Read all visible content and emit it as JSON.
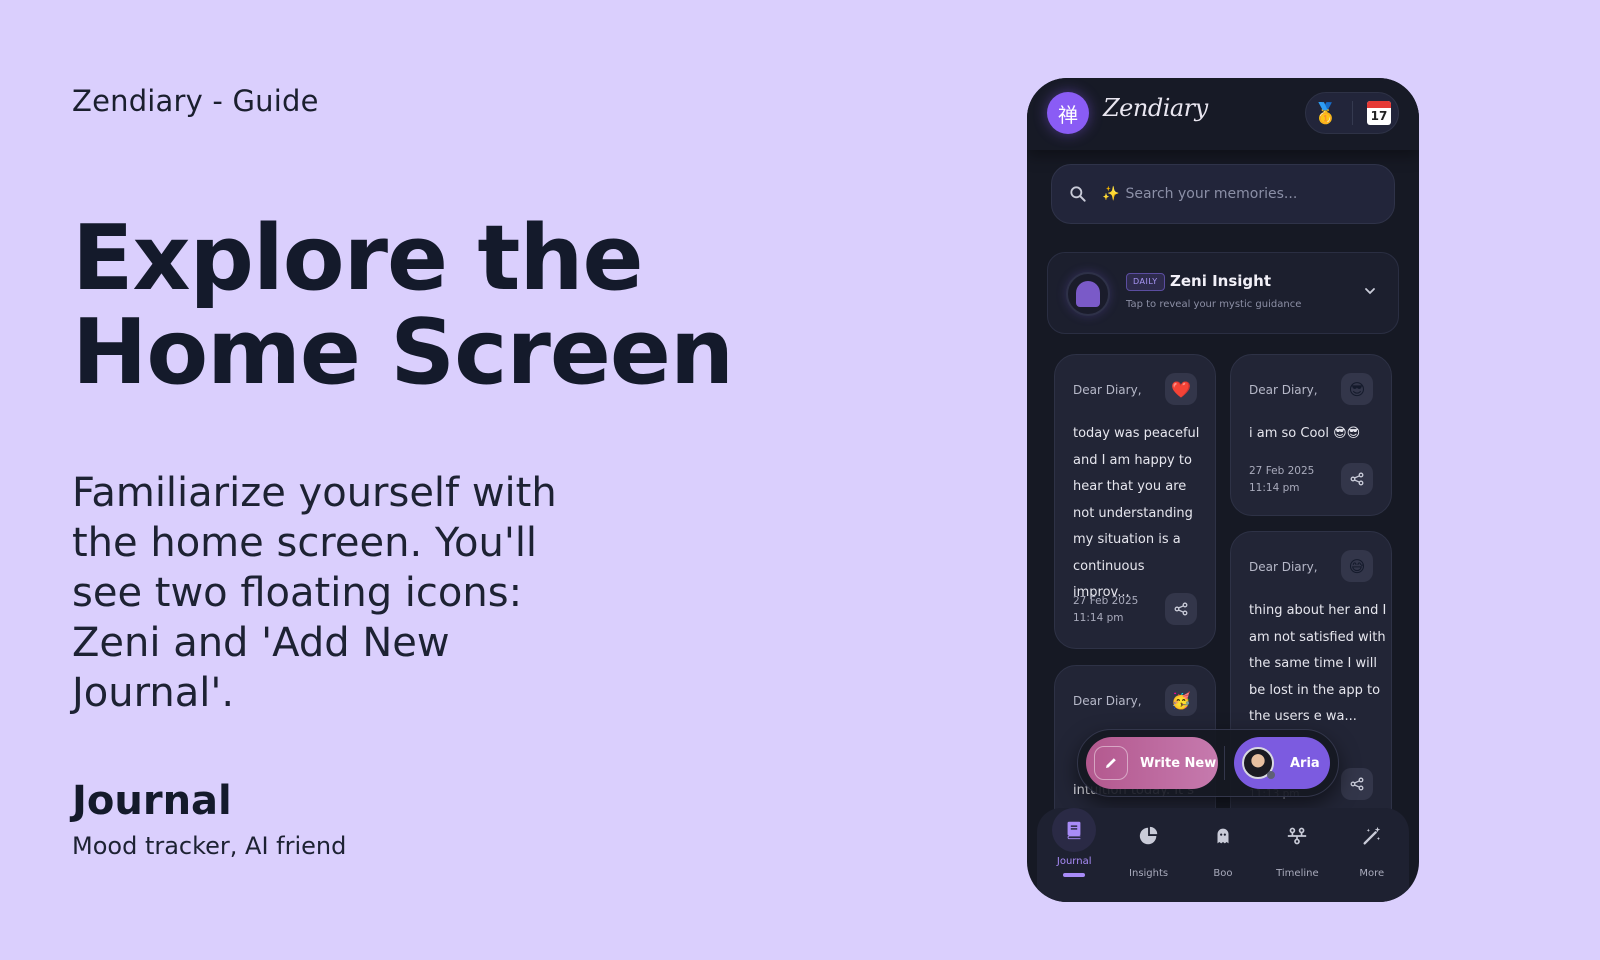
{
  "guide": {
    "title": "Zendiary - Guide",
    "hero_line1": "Explore the",
    "hero_line2": "Home Screen",
    "description": "Familiarize yourself with the home screen. You'll see two floating icons: Zeni and 'Add New Journal'.",
    "section_title": "Journal",
    "section_subtitle": "Mood tracker, AI friend"
  },
  "app": {
    "logo_glyph": "禅",
    "name": "Zendiary",
    "actions": {
      "medal_icon": "🥇",
      "calendar_day": "17"
    },
    "search": {
      "sparkle": "✨",
      "placeholder": "Search your memories..."
    },
    "insight": {
      "badge": "DAILY",
      "title": "Zeni Insight",
      "subtitle": "Tap to reveal your mystic guidance"
    },
    "entries": [
      {
        "greeting": "Dear Diary,",
        "emoji": "❤️",
        "text": "today was peaceful and I am happy to hear that you are not understanding my situation is a continuous improv...",
        "date": "27 Feb 2025",
        "time": "11:14 pm"
      },
      {
        "greeting": "Dear Diary,",
        "emoji": "😎",
        "text": "i am so Cool 😎😎",
        "date": "27 Feb 2025",
        "time": "11:14 pm"
      },
      {
        "greeting": "Dear Diary,",
        "emoji": "🥳",
        "text": "intuition today. It s"
      },
      {
        "greeting": "Dear Diary,",
        "emoji": "😅",
        "text": "thing about her and I am not satisfied with the same time I will be lost in the app to the users e wa...",
        "time": "11:13 pm"
      }
    ],
    "fab": {
      "write_label": "Write New",
      "aria_label": "Aria"
    },
    "tabs": [
      {
        "label": "Journal",
        "active": true
      },
      {
        "label": "Insights",
        "active": false
      },
      {
        "label": "Boo",
        "active": false
      },
      {
        "label": "Timeline",
        "active": false
      },
      {
        "label": "More",
        "active": false
      }
    ],
    "colors": {
      "accent": "#8a5cf5",
      "write_button": "#b3588e",
      "aria_button": "#7c5be0",
      "background": "#dacffd"
    }
  }
}
